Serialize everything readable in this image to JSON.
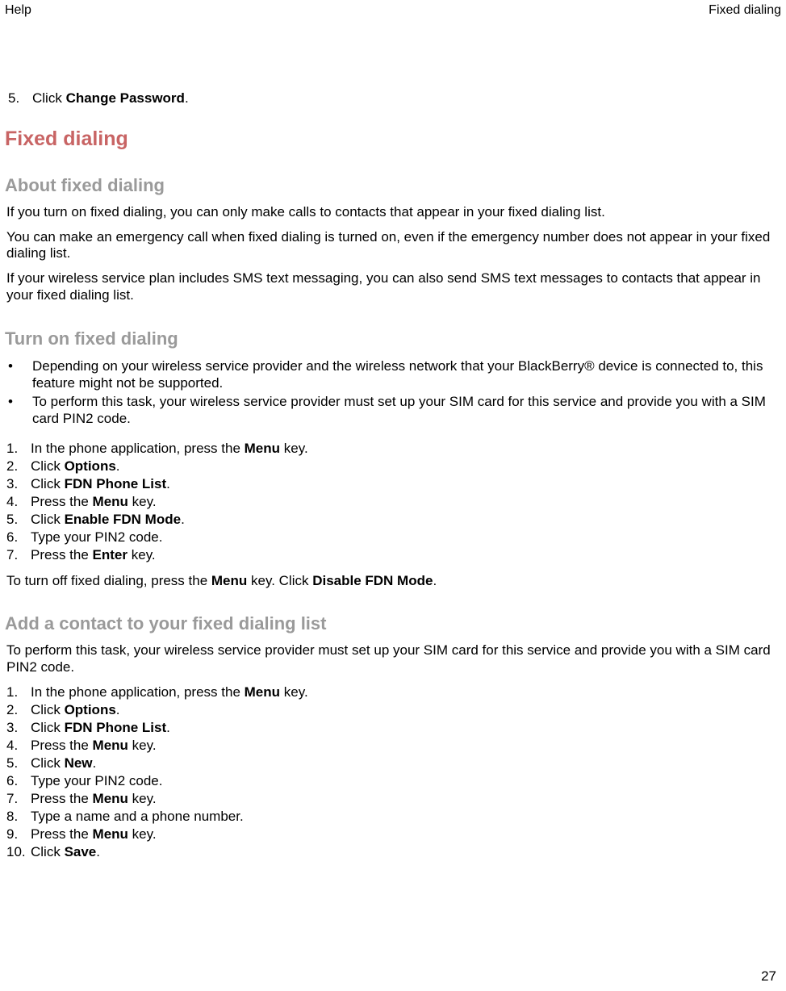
{
  "header": {
    "left": "Help",
    "right": "Fixed dialing"
  },
  "intro_step": {
    "num": "5.",
    "pre": "Click ",
    "bold": "Change Password",
    "post": "."
  },
  "h1": "Fixed dialing",
  "section_about": {
    "title": "About fixed dialing",
    "p1": "If you turn on fixed dialing, you can only make calls to contacts that appear in your fixed dialing list.",
    "p2": "You can make an emergency call when fixed dialing is turned on, even if the emergency number does not appear in your fixed dialing list.",
    "p3": "If your wireless service plan includes SMS text messaging, you can also send SMS text messages to contacts that appear in your fixed dialing list."
  },
  "section_turnon": {
    "title": "Turn on fixed dialing",
    "bullets": [
      "Depending on your wireless service provider and the wireless network that your BlackBerry® device is connected to, this feature might not be supported.",
      "To perform this task, your wireless service provider must set up your SIM card for this service and provide you with a SIM card PIN2 code."
    ],
    "steps": [
      {
        "num": "1.",
        "parts": [
          {
            "t": "In the phone application, press the "
          },
          {
            "b": "Menu"
          },
          {
            "t": " key."
          }
        ]
      },
      {
        "num": "2.",
        "parts": [
          {
            "t": "Click "
          },
          {
            "b": "Options"
          },
          {
            "t": "."
          }
        ]
      },
      {
        "num": "3.",
        "parts": [
          {
            "t": "Click "
          },
          {
            "b": "FDN Phone List"
          },
          {
            "t": "."
          }
        ]
      },
      {
        "num": "4.",
        "parts": [
          {
            "t": "Press the "
          },
          {
            "b": "Menu"
          },
          {
            "t": " key."
          }
        ]
      },
      {
        "num": "5.",
        "parts": [
          {
            "t": "Click "
          },
          {
            "b": "Enable FDN Mode"
          },
          {
            "t": "."
          }
        ]
      },
      {
        "num": "6.",
        "parts": [
          {
            "t": "Type your PIN2 code."
          }
        ]
      },
      {
        "num": "7.",
        "parts": [
          {
            "t": "Press the "
          },
          {
            "b": "Enter"
          },
          {
            "t": " key."
          }
        ]
      }
    ],
    "closing": {
      "parts": [
        {
          "t": "To turn off fixed dialing, press the "
        },
        {
          "b": "Menu"
        },
        {
          "t": " key. Click "
        },
        {
          "b": "Disable FDN Mode"
        },
        {
          "t": "."
        }
      ]
    }
  },
  "section_add": {
    "title": "Add a contact to your fixed dialing list",
    "intro": "To perform this task, your wireless service provider must set up your SIM card for this service and provide you with a SIM card PIN2 code.",
    "steps": [
      {
        "num": "1.",
        "parts": [
          {
            "t": "In the phone application, press the "
          },
          {
            "b": "Menu"
          },
          {
            "t": " key."
          }
        ]
      },
      {
        "num": "2.",
        "parts": [
          {
            "t": "Click "
          },
          {
            "b": "Options"
          },
          {
            "t": "."
          }
        ]
      },
      {
        "num": "3.",
        "parts": [
          {
            "t": "Click "
          },
          {
            "b": "FDN Phone List"
          },
          {
            "t": "."
          }
        ]
      },
      {
        "num": "4.",
        "parts": [
          {
            "t": "Press the "
          },
          {
            "b": "Menu"
          },
          {
            "t": " key."
          }
        ]
      },
      {
        "num": "5.",
        "parts": [
          {
            "t": "Click "
          },
          {
            "b": "New"
          },
          {
            "t": "."
          }
        ]
      },
      {
        "num": "6.",
        "parts": [
          {
            "t": "Type your PIN2 code."
          }
        ]
      },
      {
        "num": "7.",
        "parts": [
          {
            "t": "Press the "
          },
          {
            "b": "Menu"
          },
          {
            "t": " key."
          }
        ]
      },
      {
        "num": "8.",
        "parts": [
          {
            "t": "Type a name and a phone number."
          }
        ]
      },
      {
        "num": "9.",
        "parts": [
          {
            "t": "Press the "
          },
          {
            "b": "Menu"
          },
          {
            "t": " key."
          }
        ]
      },
      {
        "num": "10.",
        "parts": [
          {
            "t": "Click "
          },
          {
            "b": "Save"
          },
          {
            "t": "."
          }
        ]
      }
    ]
  },
  "page_number": "27"
}
